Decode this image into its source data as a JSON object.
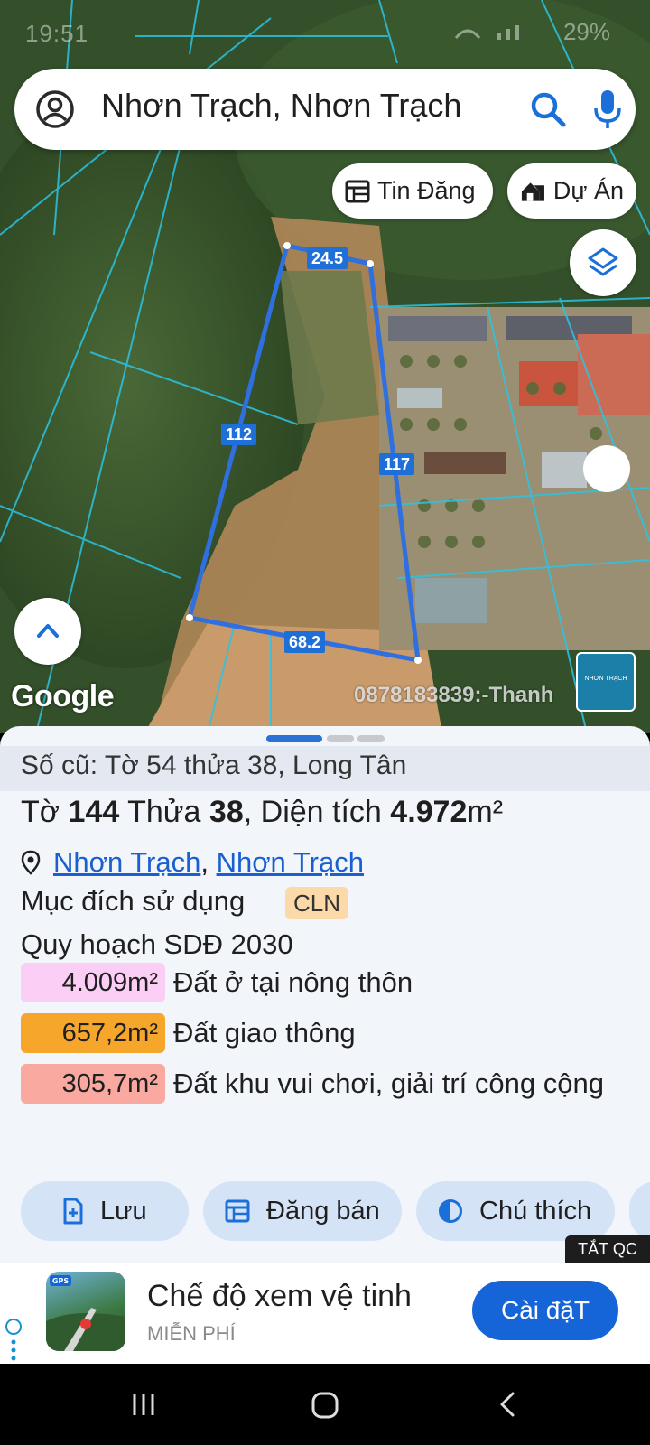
{
  "status_bar": {
    "time": "19:51",
    "battery": "29%"
  },
  "search": {
    "query": "Nhơn Trạch, Nhơn Trạch"
  },
  "chips": {
    "listing": "Tin Đăng",
    "project": "Dự Án"
  },
  "map": {
    "dimensions": {
      "top": "24.5",
      "left": "112",
      "right": "117",
      "bottom": "68.2"
    },
    "google_logo": "Google",
    "watermark": "0878183839:-Thanh",
    "thumbnail_text": "NHƠN TRẠCH",
    "boundary_color": "#2f6fe0"
  },
  "sheet": {
    "old_id": "Số cũ: Tờ 54 thửa 38, Long Tân",
    "sheet_label": "Tờ",
    "sheet_no": "144",
    "plot_label": "Thửa",
    "plot_no": "38",
    "area_label": ", Diện tích",
    "area": "4.972",
    "area_unit": "m²",
    "location": {
      "district": "Nhơn Trạch",
      "separator": ",",
      "ward": "Nhơn Trạch"
    },
    "purpose_label": "Mục đích sử dụng",
    "purpose_code": "CLN",
    "plan_label": "Quy hoạch SDĐ 2030",
    "zones": [
      {
        "area": "4.009m²",
        "label": "Đất ở tại nông thôn",
        "color": "#fbcff5"
      },
      {
        "area": "657,2m²",
        "label": "Đất giao thông",
        "color": "#f7a62c"
      },
      {
        "area": "305,7m²",
        "label": "Đất khu vui chơi, giải trí công cộng",
        "color": "#f9a9a0"
      }
    ],
    "actions": {
      "save": "Lưu",
      "post": "Đăng bán",
      "legend": "Chú thích"
    },
    "ad_close": "TẮT QC"
  },
  "ad": {
    "title": "Chế độ xem vệ tinh",
    "subtitle": "MIỄN PHÍ",
    "cta": "Cài đặT",
    "icon_text": "GPS"
  },
  "colors": {
    "accent": "#1a5fcf",
    "button_bg": "#d5e3f7",
    "cta": "#1565d8"
  }
}
